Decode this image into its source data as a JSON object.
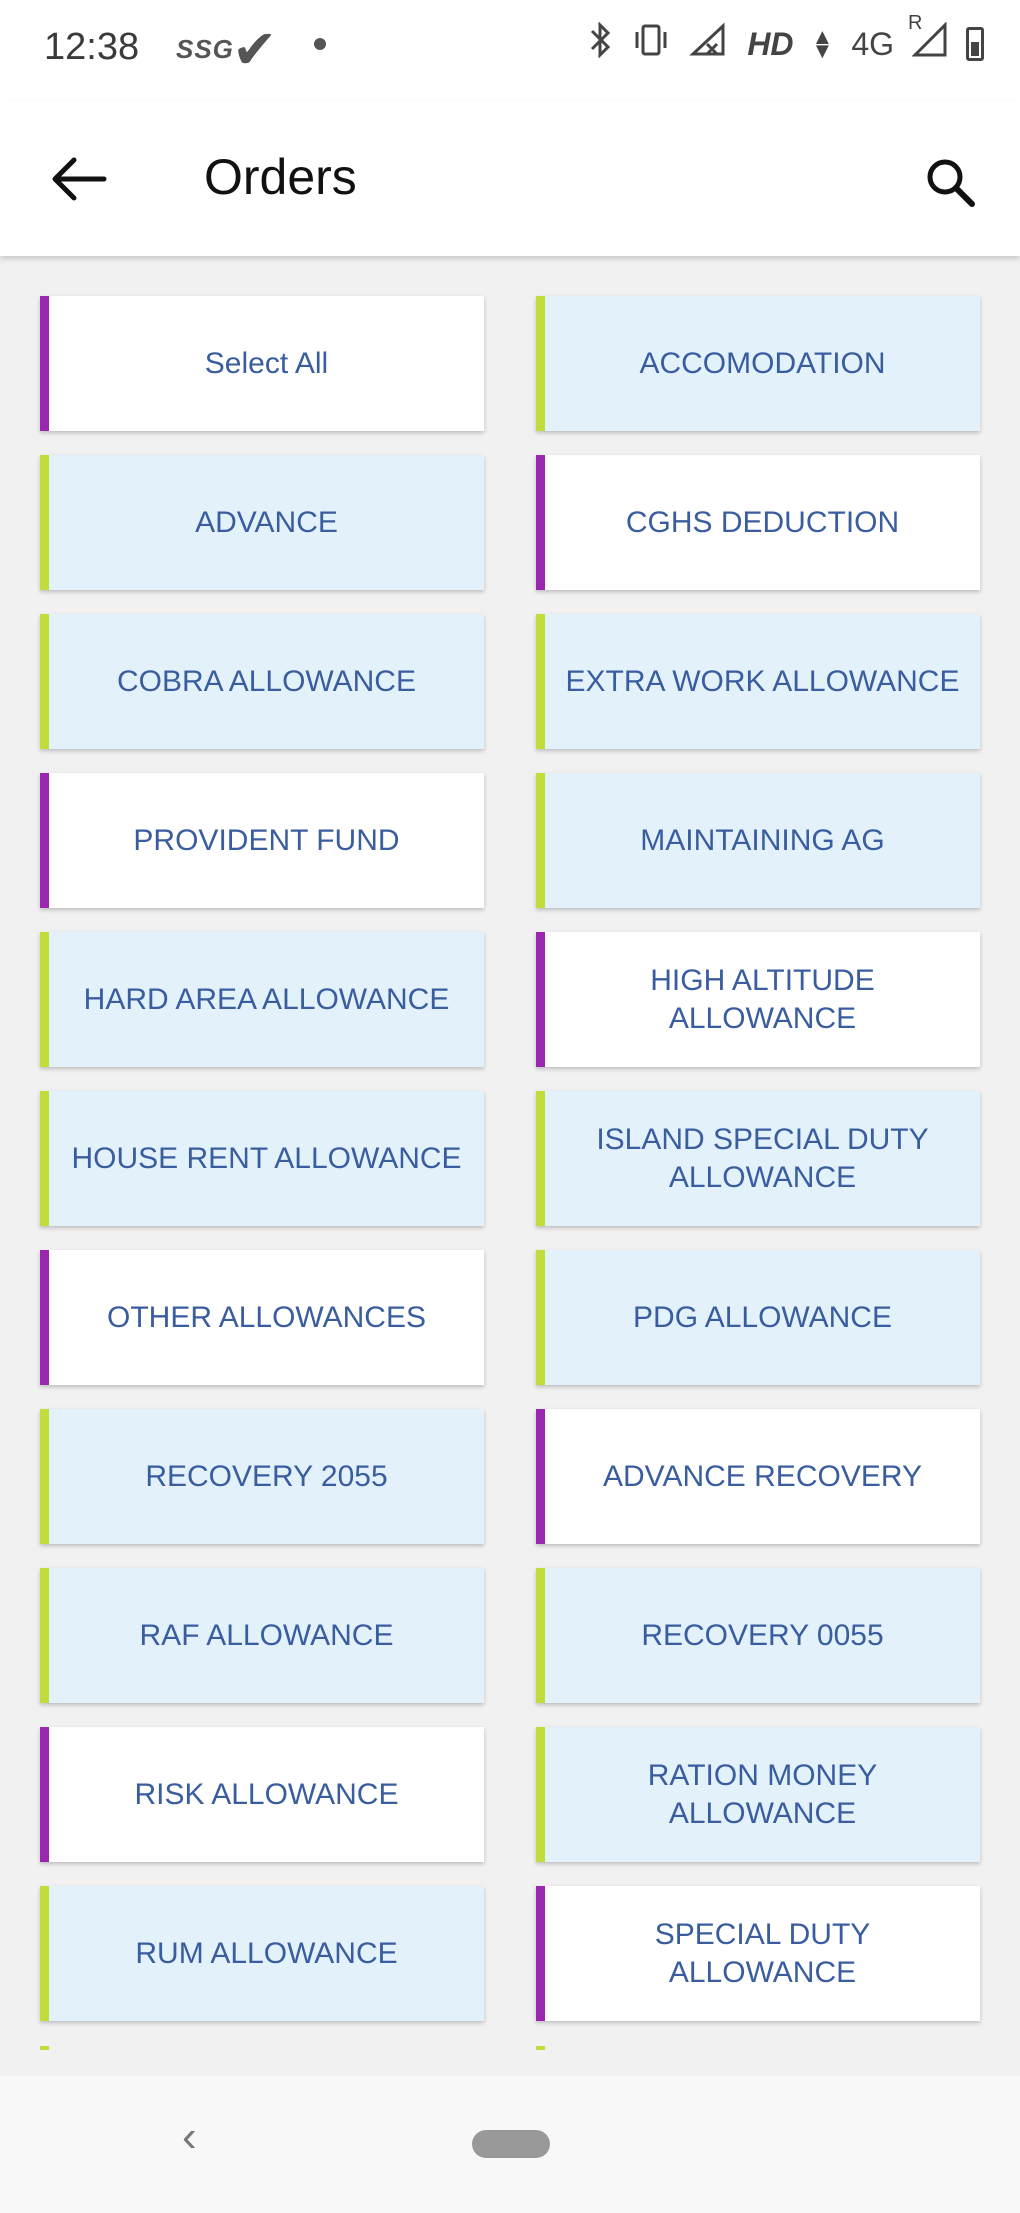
{
  "status_bar": {
    "time": "12:38",
    "carrier_badge": "SSG",
    "network_hd": "HD",
    "network_type": "4G",
    "roaming": "R",
    "icons": [
      "bluetooth-icon",
      "vibrate-icon",
      "signal-off-icon",
      "data-arrows-icon",
      "signal-icon",
      "battery-icon"
    ]
  },
  "app_bar": {
    "title": "Orders",
    "back_icon": "arrow-left-icon",
    "search_icon": "search-icon"
  },
  "colors": {
    "accent_purple": "#9b27b0",
    "accent_lime": "#c3dc3a",
    "card_blue": "#e3f1fb",
    "card_white": "#ffffff",
    "text_blue": "#3a5d9f"
  },
  "orders": [
    {
      "label": "Select All",
      "style": "white",
      "accent": "purple"
    },
    {
      "label": "ACCOMODATION",
      "style": "blue",
      "accent": "lime"
    },
    {
      "label": "ADVANCE",
      "style": "blue",
      "accent": "lime"
    },
    {
      "label": "CGHS DEDUCTION",
      "style": "white",
      "accent": "purple"
    },
    {
      "label": "COBRA ALLOWANCE",
      "style": "blue",
      "accent": "lime"
    },
    {
      "label": "EXTRA WORK ALLOWANCE",
      "style": "blue",
      "accent": "lime"
    },
    {
      "label": "PROVIDENT FUND",
      "style": "white",
      "accent": "purple"
    },
    {
      "label": "MAINTAINING AG",
      "style": "blue",
      "accent": "lime"
    },
    {
      "label": "HARD AREA ALLOWANCE",
      "style": "blue",
      "accent": "lime"
    },
    {
      "label": "HIGH ALTITUDE ALLOWANCE",
      "style": "white",
      "accent": "purple"
    },
    {
      "label": "HOUSE RENT ALLOWANCE",
      "style": "blue",
      "accent": "lime"
    },
    {
      "label": "ISLAND SPECIAL DUTY ALLOWANCE",
      "style": "blue",
      "accent": "lime"
    },
    {
      "label": "OTHER ALLOWANCES",
      "style": "white",
      "accent": "purple"
    },
    {
      "label": "PDG ALLOWANCE",
      "style": "blue",
      "accent": "lime"
    },
    {
      "label": "RECOVERY 2055",
      "style": "blue",
      "accent": "lime"
    },
    {
      "label": "ADVANCE RECOVERY",
      "style": "white",
      "accent": "purple"
    },
    {
      "label": "RAF ALLOWANCE",
      "style": "blue",
      "accent": "lime"
    },
    {
      "label": "RECOVERY 0055",
      "style": "blue",
      "accent": "lime"
    },
    {
      "label": "RISK ALLOWANCE",
      "style": "white",
      "accent": "purple"
    },
    {
      "label": "RATION MONEY ALLOWANCE",
      "style": "blue",
      "accent": "lime"
    },
    {
      "label": "RUM ALLOWANCE",
      "style": "blue",
      "accent": "lime"
    },
    {
      "label": "SPECIAL DUTY ALLOWANCE",
      "style": "white",
      "accent": "purple"
    }
  ],
  "nav_bar": {
    "back_icon": "chevron-left-icon",
    "home_icon": "home-pill-icon"
  }
}
